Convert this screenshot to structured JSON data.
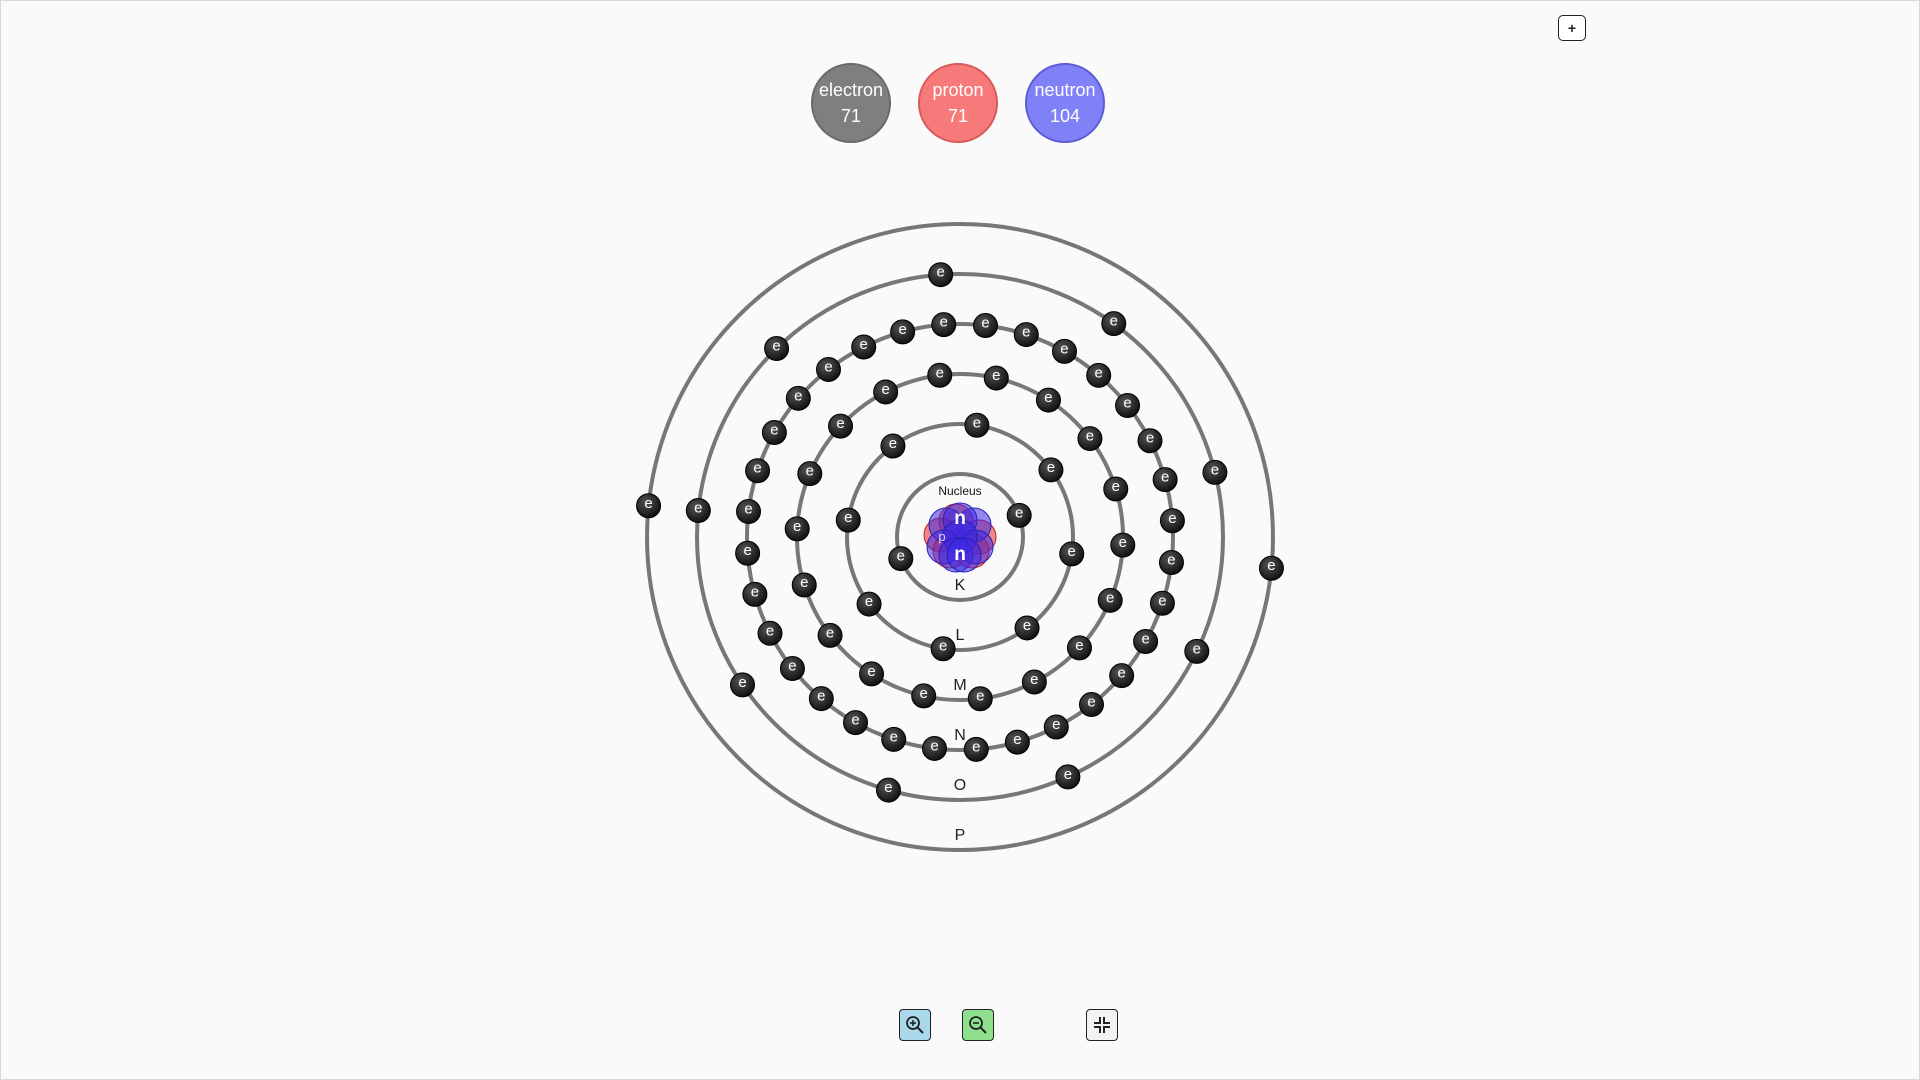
{
  "toolbar": {
    "expand_label": "+",
    "zoom_in_icon": "zoom-in-icon",
    "zoom_out_icon": "zoom-out-icon",
    "fit_icon": "collapse-icon"
  },
  "counts": {
    "electron": {
      "label": "electron",
      "value": "71"
    },
    "proton": {
      "label": "proton",
      "value": "71"
    },
    "neutron": {
      "label": "neutron",
      "value": "104"
    }
  },
  "atom": {
    "nucleus_label": "Nucleus",
    "nucleon_proton_symbol": "p",
    "nucleon_neutron_symbol": "n",
    "electron_symbol": "e",
    "shells": [
      {
        "name": "K",
        "electrons": 2
      },
      {
        "name": "L",
        "electrons": 8
      },
      {
        "name": "M",
        "electrons": 18
      },
      {
        "name": "N",
        "electrons": 32
      },
      {
        "name": "O",
        "electrons": 9
      },
      {
        "name": "P",
        "electrons": 2
      }
    ]
  },
  "colors": {
    "electron": "#7f7f7f",
    "proton": "#f77a7a",
    "neutron": "#8080f7",
    "orbit": "#777777",
    "electron_ball": "#222222"
  }
}
